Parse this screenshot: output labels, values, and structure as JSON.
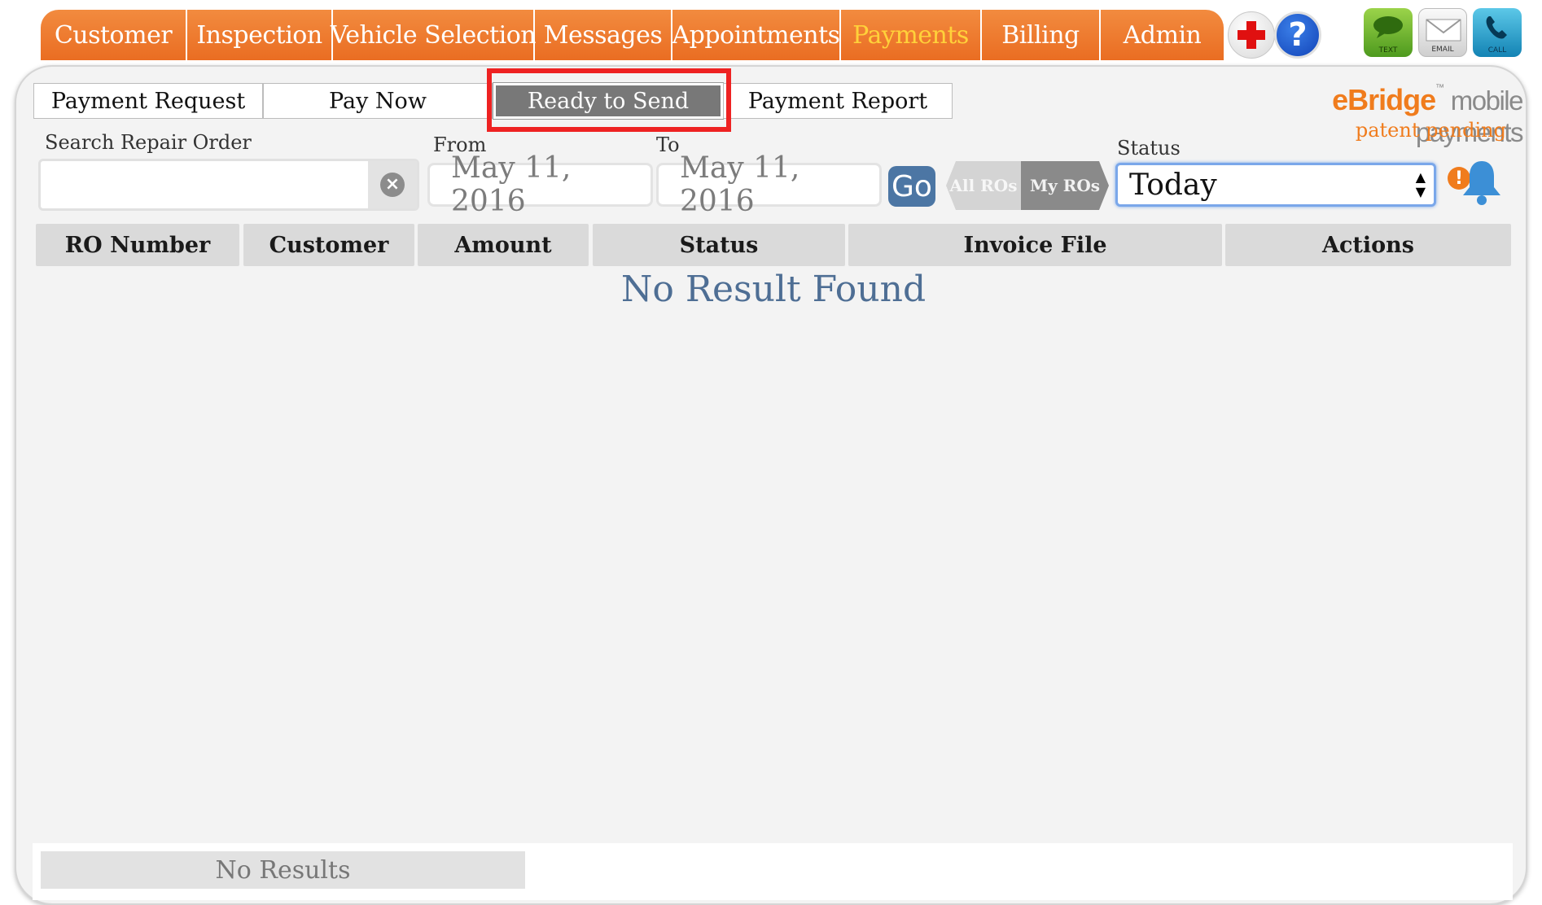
{
  "nav": {
    "tabs": [
      {
        "label": "Customer",
        "active": false
      },
      {
        "label": "Inspection",
        "active": false
      },
      {
        "label": "Vehicle Selection",
        "active": false
      },
      {
        "label": "Messages",
        "active": false
      },
      {
        "label": "Appointments",
        "active": false
      },
      {
        "label": "Payments",
        "active": true
      },
      {
        "label": "Billing",
        "active": false
      },
      {
        "label": "Admin",
        "active": false
      }
    ],
    "help_glyph": "?",
    "contact_icons": {
      "text_label": "TEXT",
      "email_label": "EMAIL",
      "call_label": "CALL"
    }
  },
  "subtabs": [
    {
      "label": "Payment Request",
      "active": false
    },
    {
      "label": "Pay Now",
      "active": false
    },
    {
      "label": "Ready to Send",
      "active": true
    },
    {
      "label": "Payment Report",
      "active": false
    }
  ],
  "brand": {
    "name": "eBridge",
    "trademark": "™",
    "product": " mobile payments",
    "tagline": "patent pending"
  },
  "filters": {
    "search_label": "Search Repair Order",
    "search_value": "",
    "from_label": "From",
    "from_value": "May 11, 2016",
    "to_label": "To",
    "to_value": "May 11, 2016",
    "go_label": "Go",
    "ro_toggle": {
      "all_label": "All ROs",
      "my_label": "My ROs",
      "selected": "My ROs"
    },
    "status_label": "Status",
    "status_value": "Today",
    "alert_glyph": "!"
  },
  "table": {
    "columns": [
      "RO Number",
      "Customer",
      "Amount",
      "Status",
      "Invoice File",
      "Actions"
    ],
    "rows": [],
    "empty_message": "No Result Found"
  },
  "footer": {
    "summary": "No Results"
  },
  "colors": {
    "nav_orange": "#ea6d22",
    "active_nav_text": "#ffd13a",
    "active_subtab": "#787878",
    "highlight_red": "#ee2222",
    "go_blue": "#4c76a4",
    "empty_text": "#4e6e94"
  }
}
